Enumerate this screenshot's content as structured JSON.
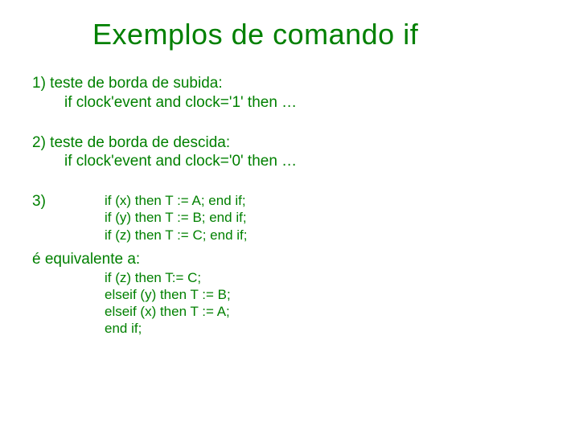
{
  "title": "Exemplos de comando if",
  "ex1": {
    "heading": "1) teste de borda de subida:",
    "code": "if clock'event and clock='1' then …"
  },
  "ex2": {
    "heading": "2) teste de borda de descida:",
    "code": "if clock'event and clock='0' then …"
  },
  "ex3": {
    "heading": "3)",
    "code1": "if (x) then T := A; end if;",
    "code2": "if (y) then T := B; end if;",
    "code3": "if (z) then T := C; end if;",
    "equiv_heading": "é equivalente a:",
    "eq1": "if (z) then T:= C;",
    "eq2": "elseif (y) then T := B;",
    "eq3": "elseif (x) then T := A;",
    "eq4": "end if;"
  }
}
